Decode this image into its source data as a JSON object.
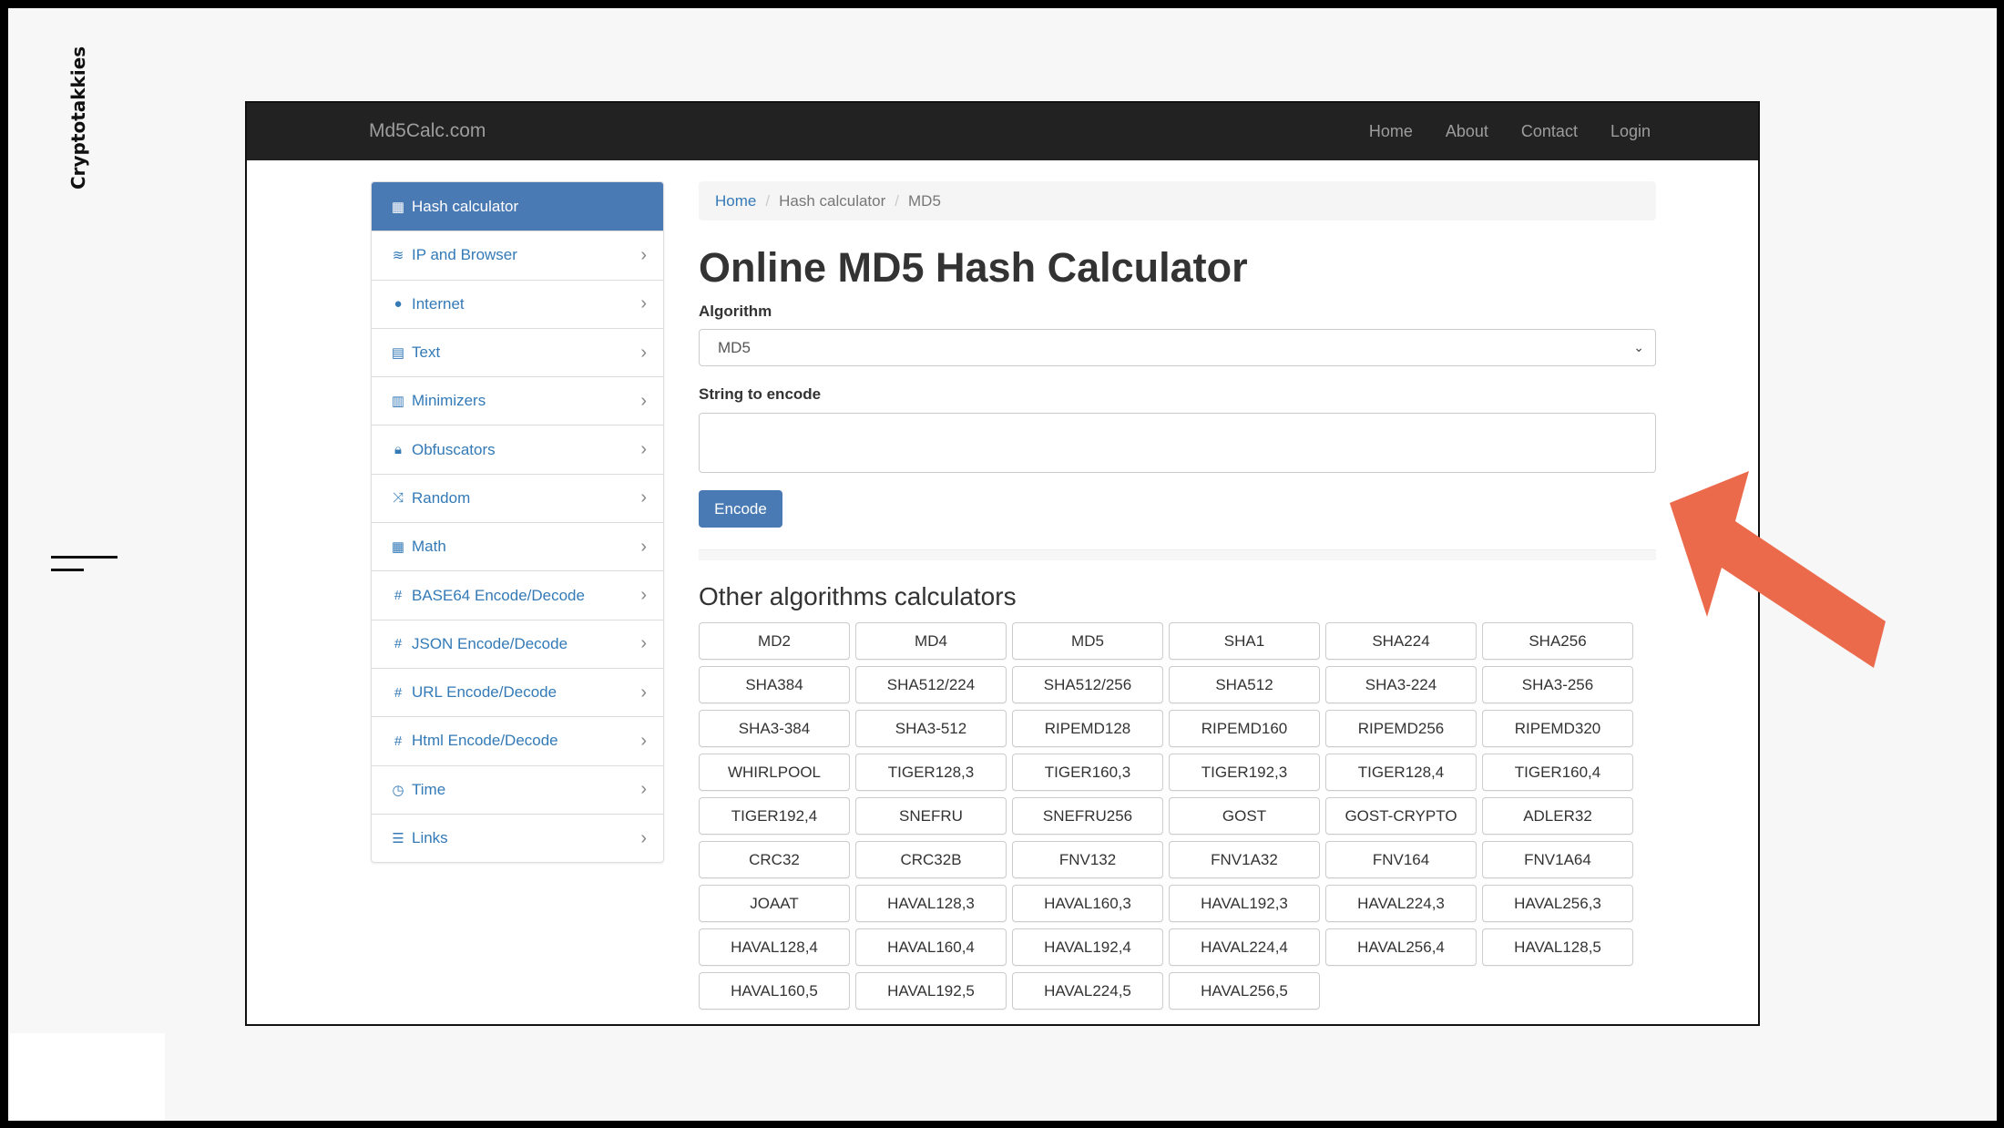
{
  "side_brand": "Cryptotakkies",
  "site": {
    "logo": "Md5Calc.com",
    "nav": [
      "Home",
      "About",
      "Contact",
      "Login"
    ]
  },
  "sidebar": {
    "items": [
      {
        "label": "Hash calculator",
        "icon": "calculator-icon"
      },
      {
        "label": "IP and Browser",
        "icon": "wifi-icon"
      },
      {
        "label": "Internet",
        "icon": "globe-icon"
      },
      {
        "label": "Text",
        "icon": "document-icon"
      },
      {
        "label": "Minimizers",
        "icon": "compress-file-icon"
      },
      {
        "label": "Obfuscators",
        "icon": "lock-icon"
      },
      {
        "label": "Random",
        "icon": "shuffle-icon"
      },
      {
        "label": "Math",
        "icon": "calculator-icon"
      },
      {
        "label": "BASE64 Encode/Decode",
        "icon": "hash-icon"
      },
      {
        "label": "JSON Encode/Decode",
        "icon": "hash-icon"
      },
      {
        "label": "URL Encode/Decode",
        "icon": "hash-icon"
      },
      {
        "label": "Html Encode/Decode",
        "icon": "hash-icon"
      },
      {
        "label": "Time",
        "icon": "clock-icon"
      },
      {
        "label": "Links",
        "icon": "list-icon"
      }
    ]
  },
  "breadcrumb": [
    "Home",
    "Hash calculator",
    "MD5"
  ],
  "main": {
    "title": "Online MD5 Hash Calculator",
    "algorithm_label": "Algorithm",
    "algorithm_value": "MD5",
    "string_label": "String to encode",
    "string_value": "",
    "encode_label": "Encode",
    "other_title": "Other algorithms calculators",
    "algorithms": [
      "MD2",
      "MD4",
      "MD5",
      "SHA1",
      "SHA224",
      "SHA256",
      "SHA384",
      "SHA512/224",
      "SHA512/256",
      "SHA512",
      "SHA3-224",
      "SHA3-256",
      "SHA3-384",
      "SHA3-512",
      "RIPEMD128",
      "RIPEMD160",
      "RIPEMD256",
      "RIPEMD320",
      "WHIRLPOOL",
      "TIGER128,3",
      "TIGER160,3",
      "TIGER192,3",
      "TIGER128,4",
      "TIGER160,4",
      "TIGER192,4",
      "SNEFRU",
      "SNEFRU256",
      "GOST",
      "GOST-CRYPTO",
      "ADLER32",
      "CRC32",
      "CRC32B",
      "FNV132",
      "FNV1A32",
      "FNV164",
      "FNV1A64",
      "JOAAT",
      "HAVAL128,3",
      "HAVAL160,3",
      "HAVAL192,3",
      "HAVAL224,3",
      "HAVAL256,3",
      "HAVAL128,4",
      "HAVAL160,4",
      "HAVAL192,4",
      "HAVAL224,4",
      "HAVAL256,4",
      "HAVAL128,5",
      "HAVAL160,5",
      "HAVAL192,5",
      "HAVAL224,5",
      "HAVAL256,5"
    ]
  },
  "colors": {
    "accent": "#4a7ab4",
    "link": "#337ab7",
    "navbar": "#222222",
    "arrow": "#ec6a4c"
  }
}
